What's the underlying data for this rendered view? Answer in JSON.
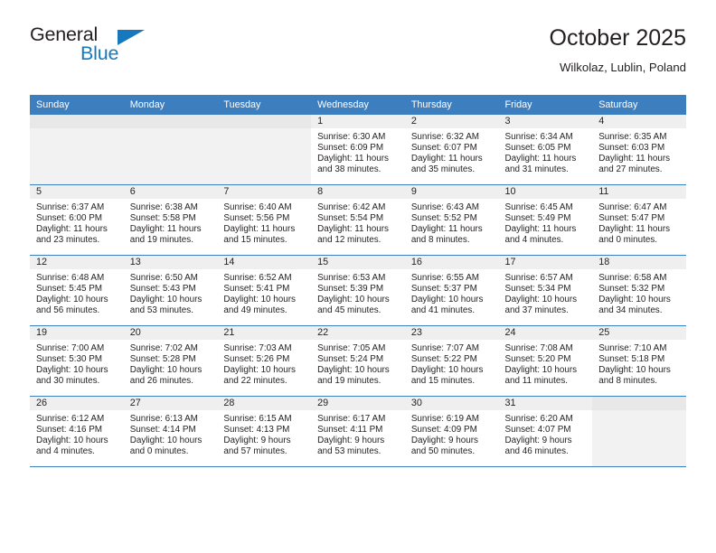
{
  "brand": {
    "name_part1": "General",
    "name_part2": "Blue",
    "accent_color": "#1878be"
  },
  "header": {
    "title": "October 2025",
    "subtitle": "Wilkolaz, Lublin, Poland",
    "header_bg_color": "#3d7ebf"
  },
  "weekday_headers": [
    "Sunday",
    "Monday",
    "Tuesday",
    "Wednesday",
    "Thursday",
    "Friday",
    "Saturday"
  ],
  "labels": {
    "sunrise_prefix": "Sunrise:",
    "sunset_prefix": "Sunset:",
    "daylight_prefix": "Daylight:"
  },
  "weeks": [
    [
      {
        "day": "",
        "empty": true
      },
      {
        "day": "",
        "empty": true
      },
      {
        "day": "",
        "empty": true
      },
      {
        "day": "1",
        "sunrise": "Sunrise: 6:30 AM",
        "sunset": "Sunset: 6:09 PM",
        "daylight_line1": "Daylight: 11 hours",
        "daylight_line2": "and 38 minutes."
      },
      {
        "day": "2",
        "sunrise": "Sunrise: 6:32 AM",
        "sunset": "Sunset: 6:07 PM",
        "daylight_line1": "Daylight: 11 hours",
        "daylight_line2": "and 35 minutes."
      },
      {
        "day": "3",
        "sunrise": "Sunrise: 6:34 AM",
        "sunset": "Sunset: 6:05 PM",
        "daylight_line1": "Daylight: 11 hours",
        "daylight_line2": "and 31 minutes."
      },
      {
        "day": "4",
        "sunrise": "Sunrise: 6:35 AM",
        "sunset": "Sunset: 6:03 PM",
        "daylight_line1": "Daylight: 11 hours",
        "daylight_line2": "and 27 minutes."
      }
    ],
    [
      {
        "day": "5",
        "sunrise": "Sunrise: 6:37 AM",
        "sunset": "Sunset: 6:00 PM",
        "daylight_line1": "Daylight: 11 hours",
        "daylight_line2": "and 23 minutes."
      },
      {
        "day": "6",
        "sunrise": "Sunrise: 6:38 AM",
        "sunset": "Sunset: 5:58 PM",
        "daylight_line1": "Daylight: 11 hours",
        "daylight_line2": "and 19 minutes."
      },
      {
        "day": "7",
        "sunrise": "Sunrise: 6:40 AM",
        "sunset": "Sunset: 5:56 PM",
        "daylight_line1": "Daylight: 11 hours",
        "daylight_line2": "and 15 minutes."
      },
      {
        "day": "8",
        "sunrise": "Sunrise: 6:42 AM",
        "sunset": "Sunset: 5:54 PM",
        "daylight_line1": "Daylight: 11 hours",
        "daylight_line2": "and 12 minutes."
      },
      {
        "day": "9",
        "sunrise": "Sunrise: 6:43 AM",
        "sunset": "Sunset: 5:52 PM",
        "daylight_line1": "Daylight: 11 hours",
        "daylight_line2": "and 8 minutes."
      },
      {
        "day": "10",
        "sunrise": "Sunrise: 6:45 AM",
        "sunset": "Sunset: 5:49 PM",
        "daylight_line1": "Daylight: 11 hours",
        "daylight_line2": "and 4 minutes."
      },
      {
        "day": "11",
        "sunrise": "Sunrise: 6:47 AM",
        "sunset": "Sunset: 5:47 PM",
        "daylight_line1": "Daylight: 11 hours",
        "daylight_line2": "and 0 minutes."
      }
    ],
    [
      {
        "day": "12",
        "sunrise": "Sunrise: 6:48 AM",
        "sunset": "Sunset: 5:45 PM",
        "daylight_line1": "Daylight: 10 hours",
        "daylight_line2": "and 56 minutes."
      },
      {
        "day": "13",
        "sunrise": "Sunrise: 6:50 AM",
        "sunset": "Sunset: 5:43 PM",
        "daylight_line1": "Daylight: 10 hours",
        "daylight_line2": "and 53 minutes."
      },
      {
        "day": "14",
        "sunrise": "Sunrise: 6:52 AM",
        "sunset": "Sunset: 5:41 PM",
        "daylight_line1": "Daylight: 10 hours",
        "daylight_line2": "and 49 minutes."
      },
      {
        "day": "15",
        "sunrise": "Sunrise: 6:53 AM",
        "sunset": "Sunset: 5:39 PM",
        "daylight_line1": "Daylight: 10 hours",
        "daylight_line2": "and 45 minutes."
      },
      {
        "day": "16",
        "sunrise": "Sunrise: 6:55 AM",
        "sunset": "Sunset: 5:37 PM",
        "daylight_line1": "Daylight: 10 hours",
        "daylight_line2": "and 41 minutes."
      },
      {
        "day": "17",
        "sunrise": "Sunrise: 6:57 AM",
        "sunset": "Sunset: 5:34 PM",
        "daylight_line1": "Daylight: 10 hours",
        "daylight_line2": "and 37 minutes."
      },
      {
        "day": "18",
        "sunrise": "Sunrise: 6:58 AM",
        "sunset": "Sunset: 5:32 PM",
        "daylight_line1": "Daylight: 10 hours",
        "daylight_line2": "and 34 minutes."
      }
    ],
    [
      {
        "day": "19",
        "sunrise": "Sunrise: 7:00 AM",
        "sunset": "Sunset: 5:30 PM",
        "daylight_line1": "Daylight: 10 hours",
        "daylight_line2": "and 30 minutes."
      },
      {
        "day": "20",
        "sunrise": "Sunrise: 7:02 AM",
        "sunset": "Sunset: 5:28 PM",
        "daylight_line1": "Daylight: 10 hours",
        "daylight_line2": "and 26 minutes."
      },
      {
        "day": "21",
        "sunrise": "Sunrise: 7:03 AM",
        "sunset": "Sunset: 5:26 PM",
        "daylight_line1": "Daylight: 10 hours",
        "daylight_line2": "and 22 minutes."
      },
      {
        "day": "22",
        "sunrise": "Sunrise: 7:05 AM",
        "sunset": "Sunset: 5:24 PM",
        "daylight_line1": "Daylight: 10 hours",
        "daylight_line2": "and 19 minutes."
      },
      {
        "day": "23",
        "sunrise": "Sunrise: 7:07 AM",
        "sunset": "Sunset: 5:22 PM",
        "daylight_line1": "Daylight: 10 hours",
        "daylight_line2": "and 15 minutes."
      },
      {
        "day": "24",
        "sunrise": "Sunrise: 7:08 AM",
        "sunset": "Sunset: 5:20 PM",
        "daylight_line1": "Daylight: 10 hours",
        "daylight_line2": "and 11 minutes."
      },
      {
        "day": "25",
        "sunrise": "Sunrise: 7:10 AM",
        "sunset": "Sunset: 5:18 PM",
        "daylight_line1": "Daylight: 10 hours",
        "daylight_line2": "and 8 minutes."
      }
    ],
    [
      {
        "day": "26",
        "sunrise": "Sunrise: 6:12 AM",
        "sunset": "Sunset: 4:16 PM",
        "daylight_line1": "Daylight: 10 hours",
        "daylight_line2": "and 4 minutes."
      },
      {
        "day": "27",
        "sunrise": "Sunrise: 6:13 AM",
        "sunset": "Sunset: 4:14 PM",
        "daylight_line1": "Daylight: 10 hours",
        "daylight_line2": "and 0 minutes."
      },
      {
        "day": "28",
        "sunrise": "Sunrise: 6:15 AM",
        "sunset": "Sunset: 4:13 PM",
        "daylight_line1": "Daylight: 9 hours",
        "daylight_line2": "and 57 minutes."
      },
      {
        "day": "29",
        "sunrise": "Sunrise: 6:17 AM",
        "sunset": "Sunset: 4:11 PM",
        "daylight_line1": "Daylight: 9 hours",
        "daylight_line2": "and 53 minutes."
      },
      {
        "day": "30",
        "sunrise": "Sunrise: 6:19 AM",
        "sunset": "Sunset: 4:09 PM",
        "daylight_line1": "Daylight: 9 hours",
        "daylight_line2": "and 50 minutes."
      },
      {
        "day": "31",
        "sunrise": "Sunrise: 6:20 AM",
        "sunset": "Sunset: 4:07 PM",
        "daylight_line1": "Daylight: 9 hours",
        "daylight_line2": "and 46 minutes."
      },
      {
        "day": "",
        "empty": true
      }
    ]
  ]
}
